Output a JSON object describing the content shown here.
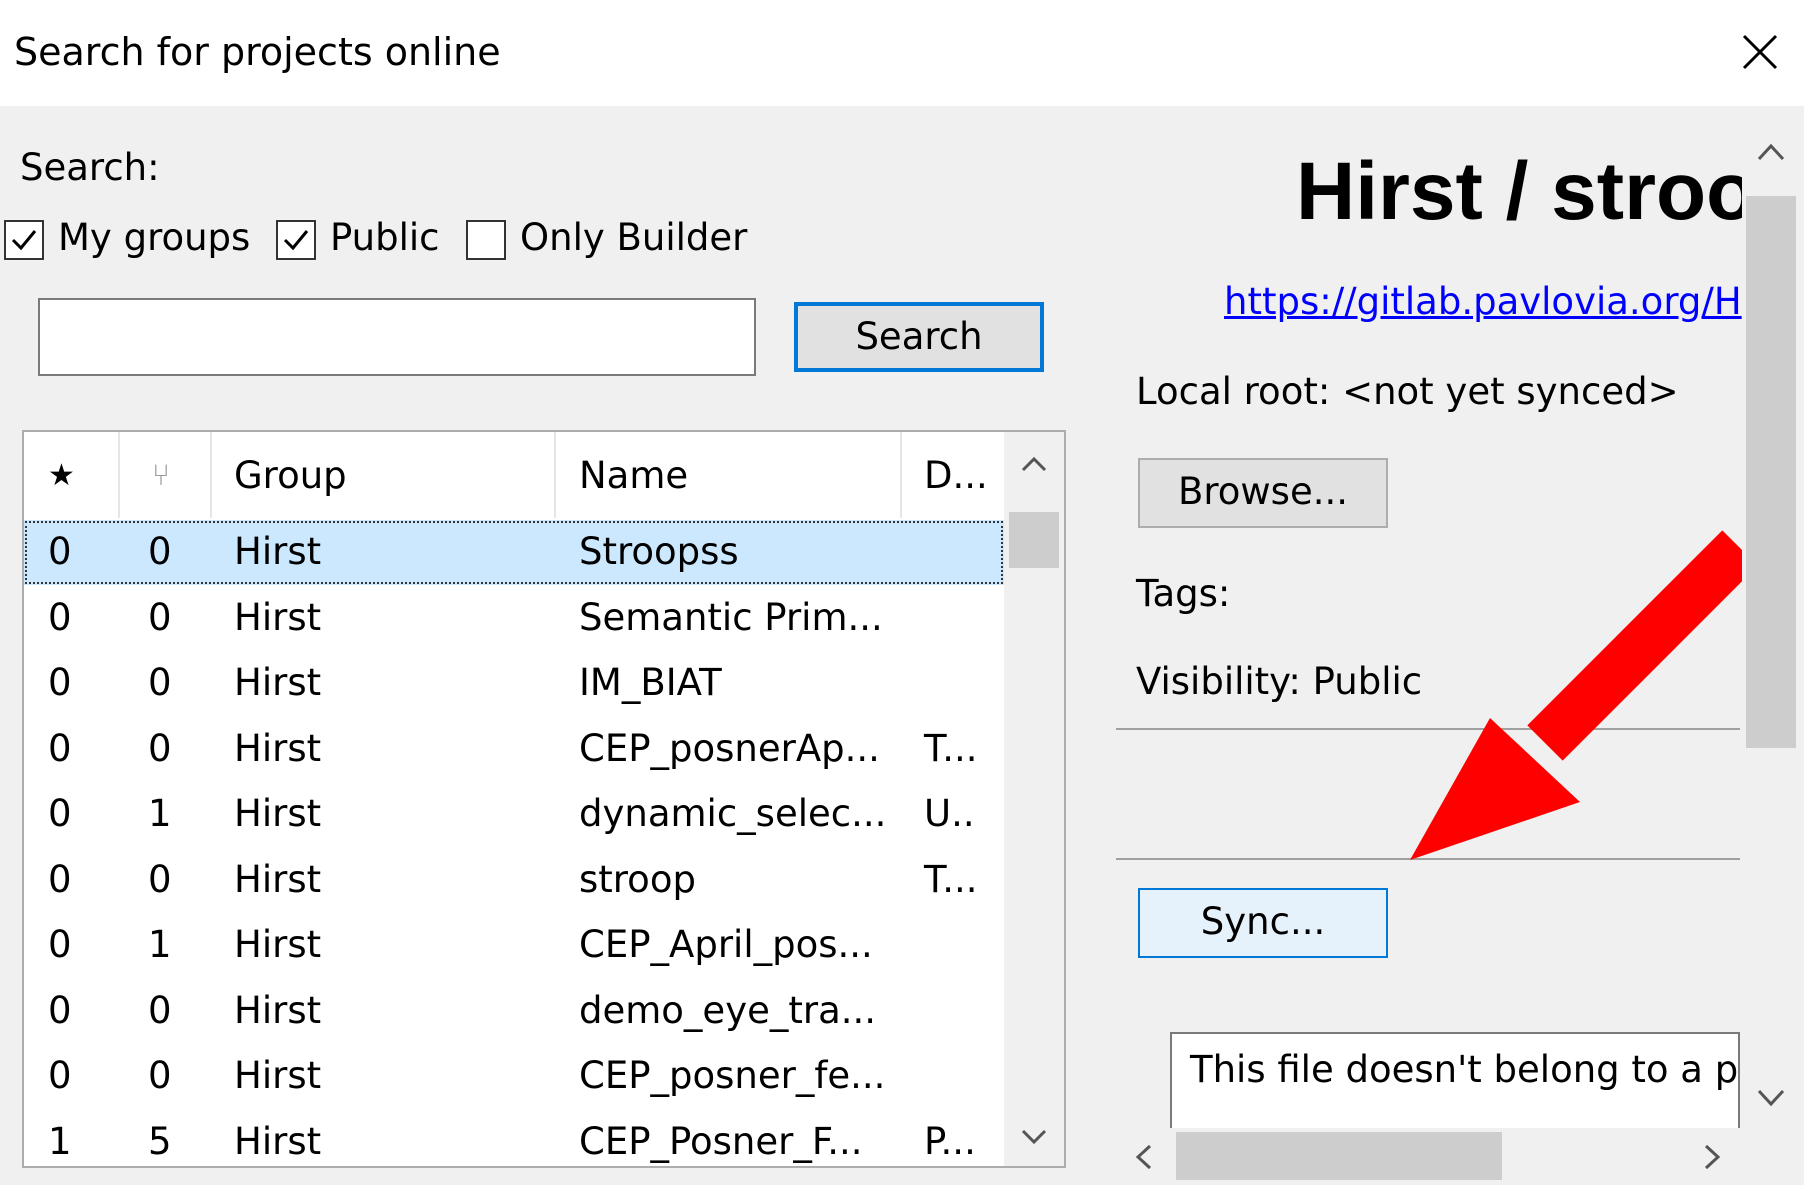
{
  "window": {
    "title": "Search for projects online"
  },
  "search": {
    "label": "Search:",
    "filters": [
      {
        "label": "My groups",
        "checked": true
      },
      {
        "label": "Public",
        "checked": true
      },
      {
        "label": "Only Builder",
        "checked": false
      }
    ],
    "input_value": "",
    "button_label": "Search"
  },
  "table": {
    "columns": [
      "★",
      "⑂",
      "Group",
      "Name",
      "D..."
    ],
    "rows": [
      [
        "0",
        "0",
        "Hirst",
        "Stroopss",
        ""
      ],
      [
        "0",
        "0",
        "Hirst",
        "Semantic Prim...",
        ""
      ],
      [
        "0",
        "0",
        "Hirst",
        "IM_BIAT",
        ""
      ],
      [
        "0",
        "0",
        "Hirst",
        "CEP_posnerAp...",
        "T..."
      ],
      [
        "0",
        "1",
        "Hirst",
        "dynamic_selec...",
        "U.."
      ],
      [
        "0",
        "0",
        "Hirst",
        "stroop",
        "T..."
      ],
      [
        "0",
        "1",
        "Hirst",
        "CEP_April_pos...",
        ""
      ],
      [
        "0",
        "0",
        "Hirst",
        "demo_eye_tra...",
        ""
      ],
      [
        "0",
        "0",
        "Hirst",
        "CEP_posner_fe...",
        ""
      ],
      [
        "1",
        "5",
        "Hirst",
        "CEP_Posner_F...",
        "P..."
      ]
    ],
    "selected_row": 0
  },
  "details": {
    "title": "Hirst / stroo",
    "url": "https://gitlab.pavlovia.org/H",
    "local_root": "Local root: <not yet synced>",
    "browse_label": "Browse...",
    "tags": "Tags:",
    "visibility": "Visibility: Public",
    "sync_label": "Sync...",
    "message": "This file doesn't belong to a pr"
  },
  "annotation": {
    "arrow_color": "#ff0000"
  }
}
